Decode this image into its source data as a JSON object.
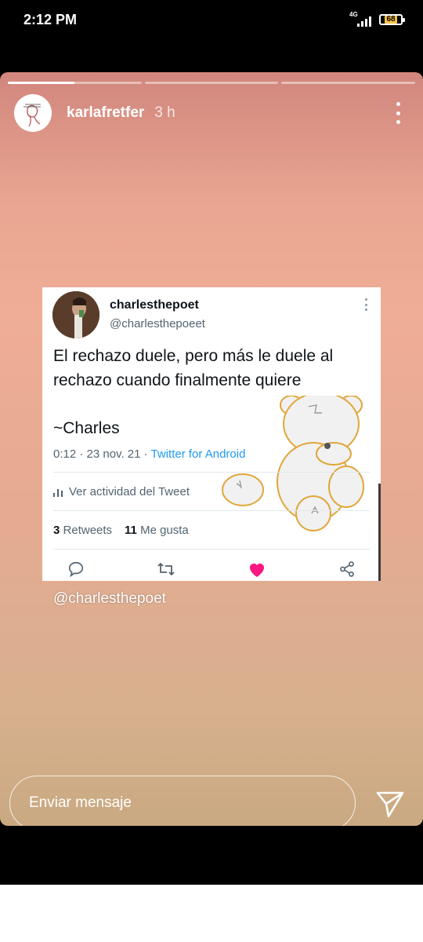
{
  "status_bar": {
    "time": "2:12 PM",
    "network": "4G",
    "battery": "68"
  },
  "story": {
    "progress": [
      1,
      0,
      0
    ],
    "current_segment_fill": 0.5,
    "username": "karlafretfer",
    "time_ago": "3 h",
    "mention": "@charlesthepoet",
    "reply_placeholder": "Enviar mensaje"
  },
  "tweet": {
    "name": "charlesthepoet",
    "handle": "@charlesthepoeet",
    "text": "El rechazo duele, pero más le duele al\nrechazo cuando finalmente quiere",
    "signature": "~Charles",
    "time": "0:12 · 23 nov. 21 · ",
    "source": "Twitter for Android",
    "activity_label": "Ver actividad del Tweet",
    "retweets_count": "3",
    "retweets_label": "Retweets",
    "likes_count": "11",
    "likes_label": "Me gusta"
  },
  "icons": {
    "reply": "comment-icon",
    "retweet": "retweet-icon",
    "like": "heart-icon",
    "share": "share-icon",
    "send": "paper-plane-icon",
    "more": "more-vertical-icon"
  },
  "colors": {
    "like_active": "#f91880",
    "twitter_blue": "#1d9bf0",
    "battery_fill": "#f6c34a"
  }
}
